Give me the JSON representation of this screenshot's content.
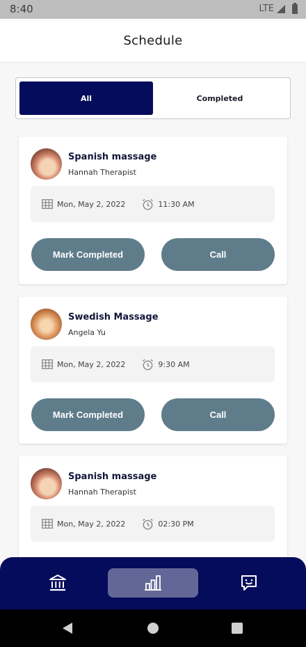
{
  "status_bar": {
    "time": "8:40",
    "network": "LTE"
  },
  "header": {
    "title": "Schedule"
  },
  "tabs": [
    {
      "label": "All",
      "active": true
    },
    {
      "label": "Completed",
      "active": false
    }
  ],
  "appointments": [
    {
      "service": "Spanish massage",
      "therapist": "Hannah Therapist",
      "date": "Mon, May 2, 2022",
      "time": "11:30 AM",
      "mark_label": "Mark Completed",
      "call_label": "Call"
    },
    {
      "service": "Swedish Massage",
      "therapist": "Angela Yu",
      "date": "Mon, May 2, 2022",
      "time": "9:30 AM",
      "mark_label": "Mark Completed",
      "call_label": "Call"
    },
    {
      "service": "Spanish massage",
      "therapist": "Hannah Therapist",
      "date": "Mon, May 2, 2022",
      "time": "02:30 PM"
    }
  ],
  "bottom_nav": [
    {
      "icon": "bank-icon",
      "active": false
    },
    {
      "icon": "bar-chart-icon",
      "active": true
    },
    {
      "icon": "chat-smile-icon",
      "active": false
    }
  ],
  "colors": {
    "primary": "#060c5c",
    "button": "#5f7c8a",
    "nav_active": "#626797"
  }
}
